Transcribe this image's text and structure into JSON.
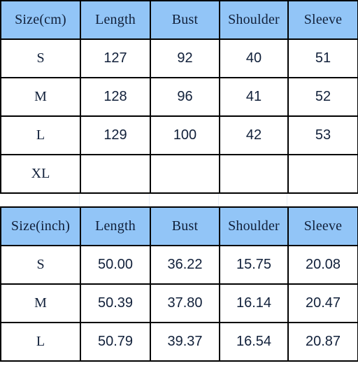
{
  "tables": [
    {
      "name": "centimeters-size-chart",
      "unit": "cm",
      "columns": [
        "Size(cm)",
        "Length",
        "Bust",
        "Shoulder",
        "Sleeve"
      ],
      "rows": [
        {
          "size": "S",
          "length": "127",
          "bust": "92",
          "shoulder": "40",
          "sleeve": "51"
        },
        {
          "size": "M",
          "length": "128",
          "bust": "96",
          "shoulder": "41",
          "sleeve": "52"
        },
        {
          "size": "L",
          "length": "129",
          "bust": "100",
          "shoulder": "42",
          "sleeve": "53"
        },
        {
          "size": "XL",
          "length": "",
          "bust": "",
          "shoulder": "",
          "sleeve": ""
        }
      ]
    },
    {
      "name": "inches-size-chart",
      "unit": "inch",
      "columns": [
        "Size(inch)",
        "Length",
        "Bust",
        "Shoulder",
        "Sleeve"
      ],
      "rows": [
        {
          "size": "S",
          "length": "50.00",
          "bust": "36.22",
          "shoulder": "15.75",
          "sleeve": "20.08"
        },
        {
          "size": "M",
          "length": "50.39",
          "bust": "37.80",
          "shoulder": "16.14",
          "sleeve": "20.47"
        },
        {
          "size": "L",
          "length": "50.79",
          "bust": "39.37",
          "shoulder": "16.54",
          "sleeve": "20.87"
        }
      ]
    }
  ],
  "colors": {
    "header_fill": "#92C5F7",
    "cell_fill": "#FFFFFF",
    "border": "#000000",
    "header_text": "#11203A",
    "value_text": "#1A1A1A"
  }
}
